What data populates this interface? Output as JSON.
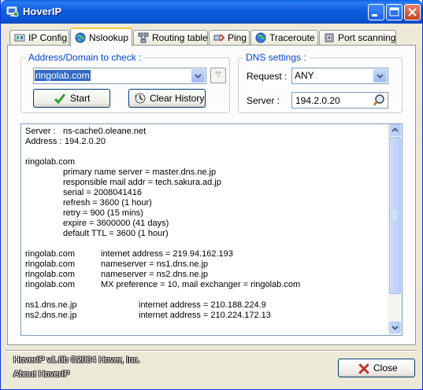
{
  "window": {
    "title": "HoverIP"
  },
  "tabs": [
    {
      "label": "IP Config",
      "icon": "ip-config-icon"
    },
    {
      "label": "Nslookup",
      "icon": "globe-icon",
      "active": true
    },
    {
      "label": "Routing table",
      "icon": "network-icon"
    },
    {
      "label": "Ping",
      "icon": "ping-icon"
    },
    {
      "label": "Traceroute",
      "icon": "globe-icon"
    },
    {
      "label": "Port scanning",
      "icon": "port-icon"
    }
  ],
  "address_group": {
    "legend": "Address/Domain to check :",
    "domain_value": "ringolab.com",
    "side_button_label": "サ",
    "start_label": "Start",
    "clear_label": "Clear History"
  },
  "dns_group": {
    "legend": "DNS settings :",
    "request_label": "Request :",
    "request_value": "ANY",
    "server_label": "Server :",
    "server_value": "194.2.0.20"
  },
  "output": {
    "lines": [
      [
        "Server :",
        "ns-cache0.oleane.net"
      ],
      [
        "Address :",
        "194.2.0.20"
      ],
      [
        "",
        ""
      ],
      [
        "ringolab.com",
        ""
      ],
      [
        "",
        "primary name server = master.dns.ne.jp"
      ],
      [
        "",
        "responsible mail addr = tech.sakura.ad.jp"
      ],
      [
        "",
        "serial = 2008041416"
      ],
      [
        "",
        "refresh = 3600 (1 hour)"
      ],
      [
        "",
        "retry = 900 (15 mins)"
      ],
      [
        "",
        "expire = 3600000 (41 days)"
      ],
      [
        "",
        "default TTL = 3600 (1 hour)"
      ],
      [
        "",
        ""
      ],
      [
        "ringolab.com",
        "internet address = 219.94.162.193"
      ],
      [
        "ringolab.com",
        "nameserver = ns1.dns.ne.jp"
      ],
      [
        "ringolab.com",
        "nameserver = ns2.dns.ne.jp"
      ],
      [
        "ringolab.com",
        "MX preference = 10, mail exchanger = ringolab.com"
      ],
      [
        "",
        ""
      ],
      [
        "ns1.dns.ne.jp",
        "internet address = 210.188.224.9"
      ],
      [
        "ns2.dns.ne.jp",
        "internet address = 210.224.172.13"
      ]
    ]
  },
  "footer": {
    "copyright": "HoverIP v1.0b ©2004 Hover, Inc.",
    "about": "About HoverIP",
    "close_label": "Close"
  }
}
